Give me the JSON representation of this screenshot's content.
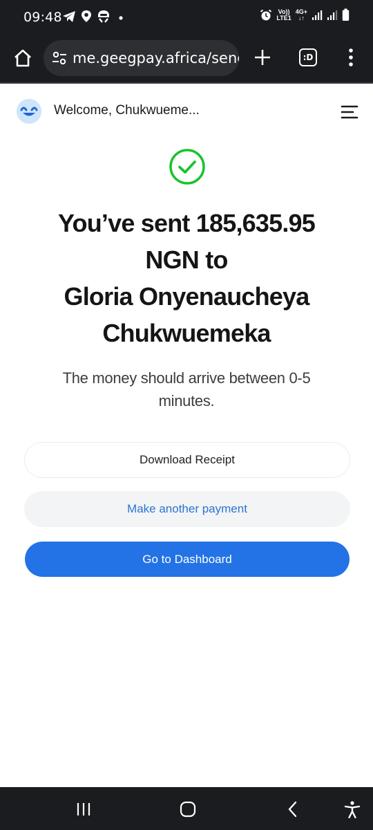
{
  "status_bar": {
    "time": "09:48",
    "left_icons": [
      "telegram-icon",
      "location-pin-icon",
      "vpn-icon",
      "dot-icon"
    ],
    "right_icons": [
      "alarm-icon",
      "volte-icon",
      "4g-icon",
      "signal-icon",
      "signal-icon-2",
      "battery-icon"
    ],
    "volte_line1": "Vo))",
    "volte_line2": "LTE1",
    "net_line1": "4G+",
    "net_line2": "↓↑"
  },
  "browser": {
    "url": "me.geegpay.africa/send",
    "tabs_label": ":D",
    "icons": [
      "home-icon",
      "site-settings-icon",
      "plus-icon",
      "tabs-icon",
      "more-vert-icon"
    ]
  },
  "header": {
    "welcome": "Welcome, Chukwueme...",
    "avatar_icon": "smile-avatar-icon",
    "menu_icon": "hamburger-menu-icon"
  },
  "main": {
    "success_icon": "check-circle-icon",
    "headline_line1": "You’ve sent 185,635.95",
    "headline_line2": "NGN to",
    "headline_line3": "Gloria Onyenaucheya",
    "headline_line4": "Chukwuemeka",
    "subtext_line1": "The money should arrive between 0-5",
    "subtext_line2": "minutes.",
    "buttons": {
      "download": "Download Receipt",
      "another": "Make another payment",
      "dashboard": "Go to Dashboard"
    }
  },
  "nav_bar": {
    "icons": [
      "recent-apps-icon",
      "home-circle-icon",
      "back-icon",
      "accessibility-icon"
    ]
  },
  "colors": {
    "accent_blue": "#2373e6",
    "link_blue": "#2874d6",
    "success_green": "#19c32b",
    "chrome_dark": "#1b1c20"
  }
}
